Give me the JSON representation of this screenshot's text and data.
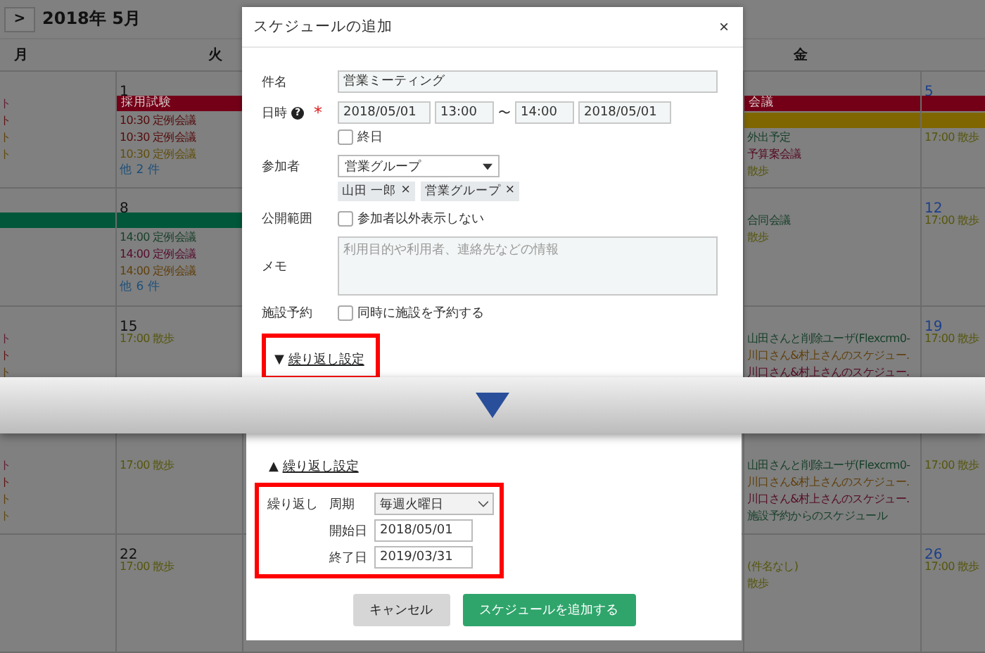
{
  "calendar": {
    "nav_button": ">",
    "month": "2018年 5月",
    "weekdays": [
      {
        "label": "月"
      },
      {
        "label": "火"
      },
      {
        "label": "金"
      }
    ]
  },
  "top_weeks": [
    {
      "cells": [
        {
          "entries": [
            {
              "kind": "event",
              "text": "ト",
              "color": "#601d34"
            },
            {
              "kind": "event",
              "text": "ト",
              "color": "#601212"
            },
            {
              "kind": "event",
              "text": "ト",
              "color": "#603f0b"
            },
            {
              "kind": "event",
              "text": "ト",
              "color": "#604a0b"
            }
          ]
        },
        {
          "kind": "weekday",
          "day": "1",
          "entries": [
            {
              "kind": "bar",
              "text": "採用試験",
              "color": "#740018"
            },
            {
              "kind": "event",
              "text": "10:30 定例会議",
              "color": "#550b0b"
            },
            {
              "kind": "event",
              "text": "10:30 定例会議",
              "color": "#550b0b"
            },
            {
              "kind": "event",
              "text": "10:30 定例会議",
              "color": "#604e0b"
            },
            {
              "kind": "more",
              "text": "他 2 件"
            }
          ]
        },
        {
          "entries": [
            {
              "kind": "bar",
              "text": "会議",
              "color": "#740018"
            },
            {
              "kind": "bar",
              "color": "#806600"
            },
            {
              "kind": "event",
              "text": "外出予定",
              "color": "#163f29"
            },
            {
              "kind": "event",
              "text": "予算案会議",
              "color": "#550b22"
            },
            {
              "kind": "event",
              "text": "散歩",
              "color": "#55550b"
            }
          ]
        },
        {
          "kind": "saturday",
          "day": "5",
          "entries": [
            {
              "kind": "bar",
              "color": "#740018"
            },
            {
              "kind": "bar",
              "color": "#806600"
            },
            {
              "kind": "event",
              "text": "17:00 散歩",
              "color": "#55550b"
            }
          ]
        }
      ]
    },
    {
      "cells": [
        {
          "entries": [
            {
              "kind": "bar",
              "color": "#00573a"
            }
          ]
        },
        {
          "kind": "weekday",
          "day": "8",
          "entries": [
            {
              "kind": "bar",
              "color": "#00573a"
            },
            {
              "kind": "event",
              "text": "14:00 定例会議",
              "color": "#163f29"
            },
            {
              "kind": "event",
              "text": "14:00 定例会議",
              "color": "#550b2d"
            },
            {
              "kind": "event",
              "text": "14:00 定例会議",
              "color": "#603f0b"
            },
            {
              "kind": "more",
              "text": "他 6 件"
            }
          ]
        },
        {
          "entries": [
            {
              "kind": "event",
              "text": "合同会議",
              "color": "#163f29"
            },
            {
              "kind": "event",
              "text": "散歩",
              "color": "#55550b"
            }
          ]
        },
        {
          "kind": "saturday",
          "day": "12",
          "entries": [
            {
              "kind": "event",
              "text": "17:00 散歩",
              "color": "#55550b"
            }
          ]
        }
      ]
    },
    {
      "cells": [
        {
          "entries": [
            {
              "kind": "event",
              "text": "ト",
              "color": "#601d34"
            },
            {
              "kind": "event",
              "text": "ト",
              "color": "#601212"
            },
            {
              "kind": "event",
              "text": "ト",
              "color": "#603f0b"
            }
          ]
        },
        {
          "kind": "weekday",
          "day": "15",
          "entries": [
            {
              "kind": "event",
              "text": "17:00 散歩",
              "color": "#55550b"
            }
          ]
        },
        {
          "entries": [
            {
              "kind": "event",
              "text": "山田さんと削除ユーザ(Flexcrm0-",
              "color": "#163f29"
            },
            {
              "kind": "event",
              "text": "川口さん&村上さんのスケジュー.",
              "color": "#603f0b"
            },
            {
              "kind": "event",
              "text": "川口さん&村上さんのスケジュー.",
              "color": "#550b22"
            }
          ]
        },
        {
          "kind": "saturday",
          "day": "19",
          "entries": [
            {
              "kind": "event",
              "text": "17:00 散歩",
              "color": "#55550b"
            }
          ]
        }
      ]
    }
  ],
  "dialog": {
    "title": "スケジュールの追加",
    "close": "×",
    "subject": {
      "label": "件名",
      "value": "営業ミーティング"
    },
    "datetime": {
      "label": "日時",
      "help": "?",
      "required": "*",
      "start_date": "2018/05/01",
      "start_time": "13:00",
      "separator": "〜",
      "end_time": "14:00",
      "end_date": "2018/05/01",
      "all_day": {
        "label": "終日",
        "checked": false
      }
    },
    "participants": {
      "label": "参加者",
      "select": "営業グループ",
      "tags": [
        {
          "label": "山田 一郎",
          "remove": "×"
        },
        {
          "label": "営業グループ",
          "remove": "×"
        }
      ]
    },
    "visibility": {
      "label": "公開範囲",
      "option": {
        "label": "参加者以外表示しない",
        "checked": false
      }
    },
    "memo": {
      "label": "メモ",
      "placeholder": "利用目的や利用者、連絡先などの情報"
    },
    "facility": {
      "label": "施設予約",
      "option": {
        "label": "同時に施設を予約する",
        "checked": false
      }
    },
    "repeat_toggle": {
      "icon": "▼",
      "label": "繰り返し設定",
      "highlighted": true
    }
  },
  "bottom_weeks": [
    {
      "cells": [
        {
          "entries": [
            {
              "kind": "event",
              "text": "ト",
              "color": "#601d34"
            },
            {
              "kind": "event",
              "text": "ト",
              "color": "#601212"
            },
            {
              "kind": "event",
              "text": "ト",
              "color": "#603f0b"
            },
            {
              "kind": "event",
              "text": "ト",
              "color": "#604a0b"
            }
          ]
        },
        {
          "entries": [
            {
              "kind": "event",
              "text": "17:00 散歩",
              "color": "#55550b"
            }
          ]
        },
        {
          "entries": [
            {
              "kind": "event",
              "text": "山田さんと削除ユーザ(Flexcrm0-",
              "color": "#163f29"
            },
            {
              "kind": "event",
              "text": "川口さん&村上さんのスケジュー.",
              "color": "#603f0b"
            },
            {
              "kind": "event",
              "text": "川口さん&村上さんのスケジュー.",
              "color": "#550b22"
            },
            {
              "kind": "event",
              "text": "施設予約からのスケジュール",
              "color": "#163f29"
            }
          ]
        },
        {
          "entries": [
            {
              "kind": "event",
              "text": "17:00 散歩",
              "color": "#55550b"
            }
          ]
        }
      ]
    },
    {
      "cells": [
        {},
        {
          "kind": "weekday",
          "day": "22",
          "entries": [
            {
              "kind": "event",
              "text": "17:00 散歩",
              "color": "#55550b"
            }
          ]
        },
        {
          "entries": [
            {
              "kind": "event",
              "text": "(件名なし)",
              "color": "#55550b"
            },
            {
              "kind": "event",
              "text": "散歩",
              "color": "#55550b"
            }
          ]
        },
        {
          "kind": "saturday",
          "day": "26",
          "entries": [
            {
              "kind": "event",
              "text": "17:00 散歩",
              "color": "#55550b"
            }
          ]
        }
      ]
    }
  ],
  "dialog_continued": {
    "repeat_toggle": {
      "icon": "▲",
      "label": "繰り返し設定",
      "highlighted": false
    },
    "repeat": {
      "highlighted": true,
      "label": "繰り返し",
      "cycle_label": "周期",
      "cycle": "毎週火曜日",
      "start_label": "開始日",
      "start": "2018/05/01",
      "end_label": "終了日",
      "end": "2019/03/31"
    },
    "buttons": [
      {
        "kind": "secondary",
        "label": "キャンセル"
      },
      {
        "kind": "primary",
        "label": "スケジュールを追加する"
      }
    ]
  }
}
